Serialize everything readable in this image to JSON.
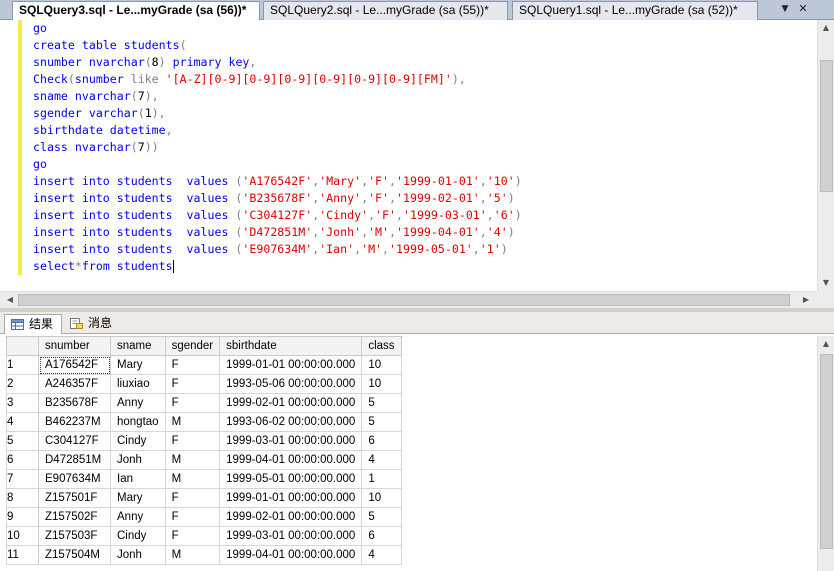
{
  "tabs": [
    {
      "label": "SQLQuery3.sql - Le...myGrade (sa (56))*",
      "active": true
    },
    {
      "label": "SQLQuery2.sql - Le...myGrade (sa (55))*",
      "active": false
    },
    {
      "label": "SQLQuery1.sql - Le...myGrade (sa (52))*",
      "active": false
    }
  ],
  "tab_close_glyph": "✕",
  "tab_dropdown_glyph": "▼",
  "editor": {
    "lines": [
      [
        {
          "t": "go",
          "c": "kw"
        }
      ],
      [
        {
          "t": "create table students",
          "c": "kw"
        },
        {
          "t": "(",
          "c": "op"
        }
      ],
      [
        {
          "t": "snumber nvarchar",
          "c": "kw"
        },
        {
          "t": "(",
          "c": "op"
        },
        {
          "t": "8",
          "c": ""
        },
        {
          "t": ")",
          "c": "op"
        },
        {
          "t": " primary key",
          "c": "kw"
        },
        {
          "t": ",",
          "c": "op"
        }
      ],
      [
        {
          "t": "Check",
          "c": "kw"
        },
        {
          "t": "(",
          "c": "op"
        },
        {
          "t": "snumber",
          "c": "kw"
        },
        {
          "t": " like ",
          "c": "op"
        },
        {
          "t": "'[A-Z][0-9][0-9][0-9][0-9][0-9][0-9][FM]'",
          "c": "str"
        },
        {
          "t": "),",
          "c": "op"
        }
      ],
      [
        {
          "t": "sname nvarchar",
          "c": "kw"
        },
        {
          "t": "(",
          "c": "op"
        },
        {
          "t": "7",
          "c": ""
        },
        {
          "t": "),",
          "c": "op"
        }
      ],
      [
        {
          "t": "sgender varchar",
          "c": "kw"
        },
        {
          "t": "(",
          "c": "op"
        },
        {
          "t": "1",
          "c": ""
        },
        {
          "t": "),",
          "c": "op"
        }
      ],
      [
        {
          "t": "sbirthdate datetime",
          "c": "kw"
        },
        {
          "t": ",",
          "c": "op"
        }
      ],
      [
        {
          "t": "class nvarchar",
          "c": "kw"
        },
        {
          "t": "(",
          "c": "op"
        },
        {
          "t": "7",
          "c": ""
        },
        {
          "t": "))",
          "c": "op"
        }
      ],
      [
        {
          "t": "go",
          "c": "kw"
        }
      ],
      [
        {
          "t": "insert into students  values ",
          "c": "kw"
        },
        {
          "t": "(",
          "c": "op"
        },
        {
          "t": "'A176542F'",
          "c": "str"
        },
        {
          "t": ",",
          "c": "op"
        },
        {
          "t": "'Mary'",
          "c": "str"
        },
        {
          "t": ",",
          "c": "op"
        },
        {
          "t": "'F'",
          "c": "str"
        },
        {
          "t": ",",
          "c": "op"
        },
        {
          "t": "'1999-01-01'",
          "c": "str"
        },
        {
          "t": ",",
          "c": "op"
        },
        {
          "t": "'10'",
          "c": "str"
        },
        {
          "t": ")",
          "c": "op"
        }
      ],
      [
        {
          "t": "insert into students  values ",
          "c": "kw"
        },
        {
          "t": "(",
          "c": "op"
        },
        {
          "t": "'B235678F'",
          "c": "str"
        },
        {
          "t": ",",
          "c": "op"
        },
        {
          "t": "'Anny'",
          "c": "str"
        },
        {
          "t": ",",
          "c": "op"
        },
        {
          "t": "'F'",
          "c": "str"
        },
        {
          "t": ",",
          "c": "op"
        },
        {
          "t": "'1999-02-01'",
          "c": "str"
        },
        {
          "t": ",",
          "c": "op"
        },
        {
          "t": "'5'",
          "c": "str"
        },
        {
          "t": ")",
          "c": "op"
        }
      ],
      [
        {
          "t": "insert into students  values ",
          "c": "kw"
        },
        {
          "t": "(",
          "c": "op"
        },
        {
          "t": "'C304127F'",
          "c": "str"
        },
        {
          "t": ",",
          "c": "op"
        },
        {
          "t": "'Cindy'",
          "c": "str"
        },
        {
          "t": ",",
          "c": "op"
        },
        {
          "t": "'F'",
          "c": "str"
        },
        {
          "t": ",",
          "c": "op"
        },
        {
          "t": "'1999-03-01'",
          "c": "str"
        },
        {
          "t": ",",
          "c": "op"
        },
        {
          "t": "'6'",
          "c": "str"
        },
        {
          "t": ")",
          "c": "op"
        }
      ],
      [
        {
          "t": "insert into students  values ",
          "c": "kw"
        },
        {
          "t": "(",
          "c": "op"
        },
        {
          "t": "'D472851M'",
          "c": "str"
        },
        {
          "t": ",",
          "c": "op"
        },
        {
          "t": "'Jonh'",
          "c": "str"
        },
        {
          "t": ",",
          "c": "op"
        },
        {
          "t": "'M'",
          "c": "str"
        },
        {
          "t": ",",
          "c": "op"
        },
        {
          "t": "'1999-04-01'",
          "c": "str"
        },
        {
          "t": ",",
          "c": "op"
        },
        {
          "t": "'4'",
          "c": "str"
        },
        {
          "t": ")",
          "c": "op"
        }
      ],
      [
        {
          "t": "insert into students  values ",
          "c": "kw"
        },
        {
          "t": "(",
          "c": "op"
        },
        {
          "t": "'E907634M'",
          "c": "str"
        },
        {
          "t": ",",
          "c": "op"
        },
        {
          "t": "'Ian'",
          "c": "str"
        },
        {
          "t": ",",
          "c": "op"
        },
        {
          "t": "'M'",
          "c": "str"
        },
        {
          "t": ",",
          "c": "op"
        },
        {
          "t": "'1999-05-01'",
          "c": "str"
        },
        {
          "t": ",",
          "c": "op"
        },
        {
          "t": "'1'",
          "c": "str"
        },
        {
          "t": ")",
          "c": "op"
        }
      ],
      [
        {
          "t": "select",
          "c": "kw"
        },
        {
          "t": "*",
          "c": "op"
        },
        {
          "t": "from students",
          "c": "kw"
        }
      ]
    ]
  },
  "results": {
    "tab_results_label": "结果",
    "tab_messages_label": "消息",
    "columns": [
      "snumber",
      "sname",
      "sgender",
      "sbirthdate",
      "class"
    ],
    "rows": [
      [
        "1",
        "A176542F",
        "Mary",
        "F",
        "1999-01-01 00:00:00.000",
        "10"
      ],
      [
        "2",
        "A246357F",
        "liuxiao",
        "F",
        "1993-05-06 00:00:00.000",
        "10"
      ],
      [
        "3",
        "B235678F",
        "Anny",
        "F",
        "1999-02-01 00:00:00.000",
        "5"
      ],
      [
        "4",
        "B462237M",
        "hongtao",
        "M",
        "1993-06-02 00:00:00.000",
        "5"
      ],
      [
        "5",
        "C304127F",
        "Cindy",
        "F",
        "1999-03-01 00:00:00.000",
        "6"
      ],
      [
        "6",
        "D472851M",
        "Jonh",
        "M",
        "1999-04-01 00:00:00.000",
        "4"
      ],
      [
        "7",
        "E907634M",
        "Ian",
        "M",
        "1999-05-01 00:00:00.000",
        "1"
      ],
      [
        "8",
        "Z157501F",
        "Mary",
        "F",
        "1999-01-01 00:00:00.000",
        "10"
      ],
      [
        "9",
        "Z157502F",
        "Anny",
        "F",
        "1999-02-01 00:00:00.000",
        "5"
      ],
      [
        "10",
        "Z157503F",
        "Cindy",
        "F",
        "1999-03-01 00:00:00.000",
        "6"
      ],
      [
        "11",
        "Z157504M",
        "Jonh",
        "M",
        "1999-04-01 00:00:00.000",
        "4"
      ]
    ]
  },
  "icons": {
    "results_grid": "grid-icon",
    "messages": "messages-icon",
    "scroll_up": "▲",
    "scroll_down": "▼",
    "scroll_left": "◀",
    "scroll_right": "▶"
  },
  "colors": {
    "keyword": "#0000ff",
    "string": "#e00000",
    "operator": "#808080",
    "change_bar": "#f4e84a"
  }
}
